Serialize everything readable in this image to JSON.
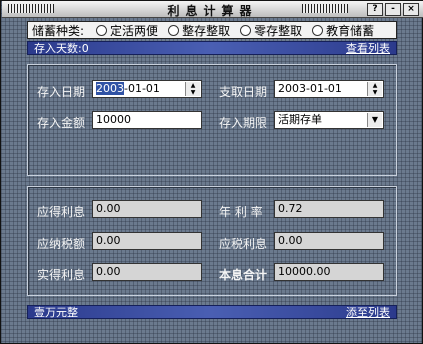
{
  "window": {
    "title": "利息计算器"
  },
  "titlebar_buttons": [
    "?",
    "-",
    "×"
  ],
  "savings_type": {
    "label": "储蓄种类:",
    "options": [
      "定活两便",
      "整存整取",
      "零存整取",
      "教育储蓄"
    ]
  },
  "info": {
    "days": "存入天数:0",
    "view_list": "查看列表"
  },
  "deposit": {
    "deposit_date_label": "存入日期",
    "deposit_date_selected": "2003",
    "deposit_date_rest": "-01-01",
    "withdraw_date_label": "支取日期",
    "withdraw_date": "2003-01-01",
    "amount_label": "存入金额",
    "amount": "10000",
    "term_label": "存入期限",
    "term": "活期存单"
  },
  "results": {
    "interest_due_label": "应得利息",
    "interest_due": "0.00",
    "annual_rate_label": "年 利 率",
    "annual_rate": "0.72",
    "tax_due_label": "应纳税额",
    "tax_due": "0.00",
    "taxable_interest_label": "应税利息",
    "taxable_interest": "0.00",
    "net_interest_label": "实得利息",
    "net_interest": "0.00",
    "total_label": "本息合计",
    "total": "10000.00"
  },
  "footer": {
    "amount_words": "壹万元整",
    "add_to_list": "添至列表"
  }
}
